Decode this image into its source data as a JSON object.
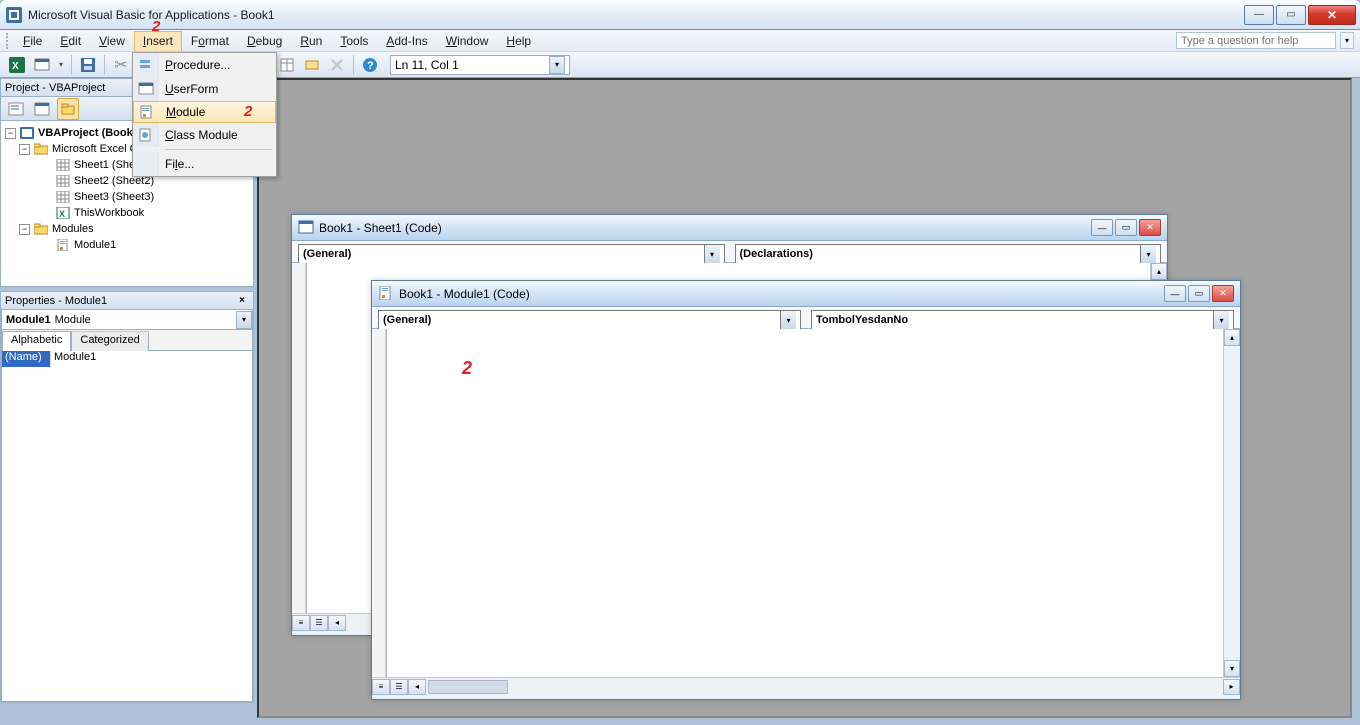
{
  "app": {
    "title": "Microsoft Visual Basic for Applications - Book1"
  },
  "menubar": {
    "file": "File",
    "edit": "Edit",
    "view": "View",
    "insert": "Insert",
    "format": "Format",
    "debug": "Debug",
    "run": "Run",
    "tools": "Tools",
    "addins": "Add-Ins",
    "window": "Window",
    "help": "Help",
    "helpSearchPlaceholder": "Type a question for help"
  },
  "toolbar": {
    "position": "Ln 11, Col 1"
  },
  "insertMenu": {
    "procedure": "Procedure...",
    "userform": "UserForm",
    "module": "Module",
    "classModule": "Class Module",
    "file": "File..."
  },
  "projectPanel": {
    "title": "Project - VBAProject",
    "root": "VBAProject (Book1)",
    "excelObjects": "Microsoft Excel Objects",
    "sheets": [
      "Sheet1 (Sheet1)",
      "Sheet2 (Sheet2)",
      "Sheet3 (Sheet3)"
    ],
    "workbook": "ThisWorkbook",
    "modulesFolder": "Modules",
    "module": "Module1"
  },
  "propertiesPanel": {
    "title": "Properties - Module1",
    "comboBold": "Module1",
    "comboRest": " Module",
    "tabs": {
      "alphabetic": "Alphabetic",
      "categorized": "Categorized"
    },
    "prop": {
      "name": "(Name)",
      "value": "Module1"
    }
  },
  "codeWin1": {
    "title": "Book1 - Sheet1 (Code)",
    "left": "(General)",
    "right": "(Declarations)"
  },
  "codeWin2": {
    "title": "Book1 - Module1 (Code)",
    "left": "(General)",
    "right": "TombolYesdanNo"
  },
  "annotations": {
    "topInsert": "2",
    "menuModule": "2",
    "codeArea": "2"
  }
}
